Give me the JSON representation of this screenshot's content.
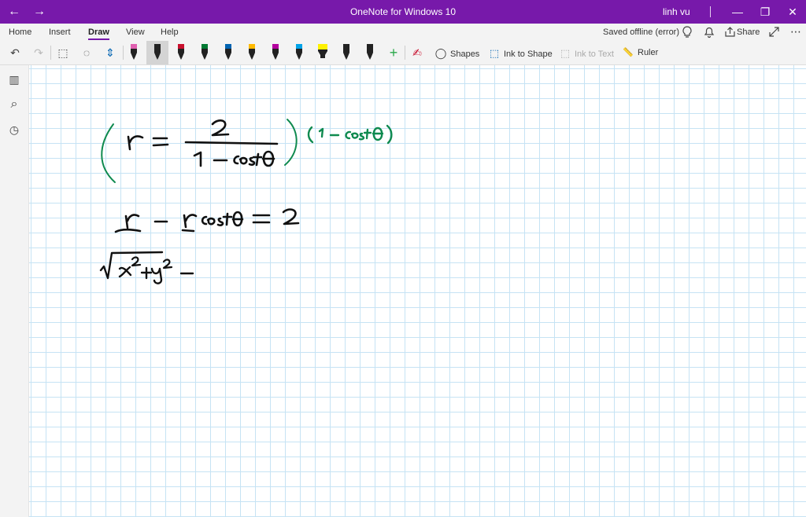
{
  "app": {
    "title": "OneNote for Windows 10",
    "user": "linh vu",
    "back_glyph": "←",
    "forward_glyph": "→",
    "minimize_glyph": "—",
    "restore_glyph": "❐",
    "close_glyph": "✕"
  },
  "ribbon": {
    "tabs": [
      {
        "label": "Home"
      },
      {
        "label": "Insert"
      },
      {
        "label": "Draw",
        "active": true
      },
      {
        "label": "View"
      },
      {
        "label": "Help"
      }
    ],
    "status": "Saved offline (error)",
    "share_label": "Share",
    "more_glyph": "⋯"
  },
  "toolbar": {
    "undo_glyph": "↶",
    "redo_glyph": "↷",
    "type_select_glyph": "⬚",
    "lasso_glyph": "◌",
    "add_space_glyph": "⇕",
    "add_pen_glyph": "+",
    "touch_draw_glyph": "✍",
    "shapes_glyph": "◯",
    "ink_to_shape_glyph": "⬚",
    "ink_to_text_glyph": "⬚",
    "ruler_glyph": "📏",
    "shapes_label": "Shapes",
    "ink_to_shape_label": "Ink to Shape",
    "ink_to_text_label": "Ink to Text",
    "ruler_label": "Ruler",
    "pen_colors": [
      "#e060b0",
      "#222222",
      "#c8102e",
      "#007a33",
      "#0063b1",
      "#ffb900",
      "#b4009e",
      "#00a2e8",
      "#fff100",
      "#222222",
      "#222222"
    ]
  },
  "leftnav": {
    "notebooks_glyph": "▥",
    "search_glyph": "⌕",
    "recent_glyph": "◷"
  },
  "page": {
    "grid_color": "#c6e3f4",
    "ink_black": "#111111",
    "ink_green": "#0f8a4f"
  }
}
